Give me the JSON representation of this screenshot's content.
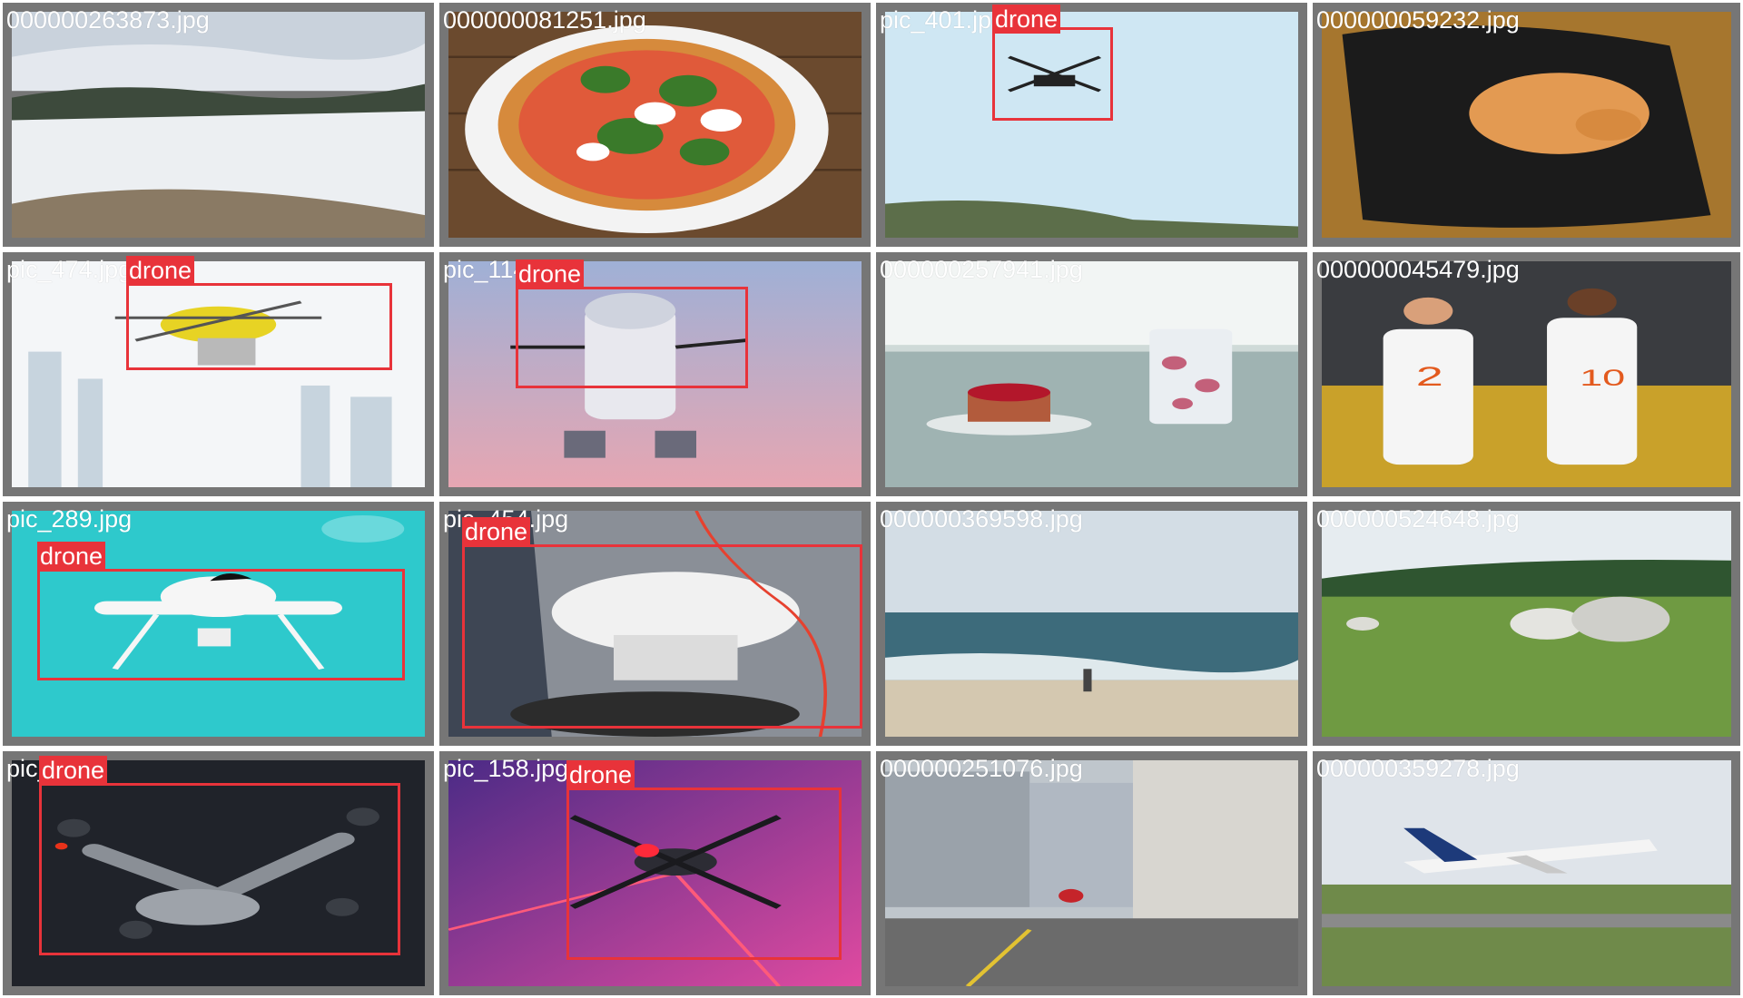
{
  "tiles": [
    {
      "filename": "000000263873.jpg",
      "scene": "snowy-hillside",
      "label": ""
    },
    {
      "filename": "000000081251.jpg",
      "scene": "pizza",
      "label": ""
    },
    {
      "filename": "pic_401.jpg",
      "scene": "drone-sky",
      "label": "drone"
    },
    {
      "filename": "000000059232.jpg",
      "scene": "cat-in-bag",
      "label": ""
    },
    {
      "filename": "pic_474.jpg",
      "scene": "drone-city",
      "label": "drone"
    },
    {
      "filename": "pic_1147.jpg",
      "scene": "r2d2-drone",
      "label": "drone"
    },
    {
      "filename": "000000257941.jpg",
      "scene": "mug-and-tart",
      "label": ""
    },
    {
      "filename": "000000045479.jpg",
      "scene": "baseball-players",
      "label": ""
    },
    {
      "filename": "pic_289.jpg",
      "scene": "cartoon-drone",
      "label": "drone"
    },
    {
      "filename": "pic_454.jpg",
      "scene": "delivery-drone",
      "label": "drone"
    },
    {
      "filename": "000000369598.jpg",
      "scene": "beach",
      "label": ""
    },
    {
      "filename": "000000524648.jpg",
      "scene": "sheep-field",
      "label": ""
    },
    {
      "filename": "pic_...jpg",
      "scene": "dark-drone",
      "label": "drone"
    },
    {
      "filename": "pic_158.jpg",
      "scene": "pink-drone",
      "label": "drone"
    },
    {
      "filename": "000000251076.jpg",
      "scene": "street",
      "label": ""
    },
    {
      "filename": "000000359278.jpg",
      "scene": "airplane",
      "label": ""
    }
  ],
  "colors": {
    "box": "#e8333a",
    "tile_border": "#767676"
  }
}
